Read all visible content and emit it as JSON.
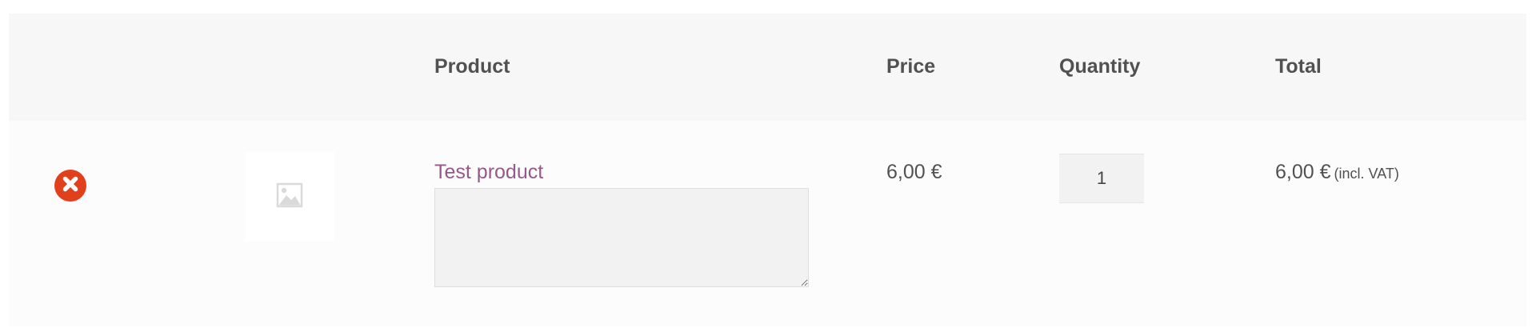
{
  "table": {
    "headers": {
      "product": "Product",
      "price": "Price",
      "quantity": "Quantity",
      "total": "Total"
    },
    "row": {
      "remove_icon": "close-icon",
      "thumbnail_icon": "image-placeholder-icon",
      "product_name": "Test product",
      "note_value": "",
      "price": "6,00 €",
      "quantity": "1",
      "total_amount": "6,00 €",
      "total_tax_label": "(incl. VAT)"
    }
  },
  "colors": {
    "header_background": "#f7f7f7",
    "row_background": "#fcfcfc",
    "text": "#515151",
    "link": "#96588a",
    "remove_button": "#e2401c",
    "input_background": "#f2f2f2"
  }
}
